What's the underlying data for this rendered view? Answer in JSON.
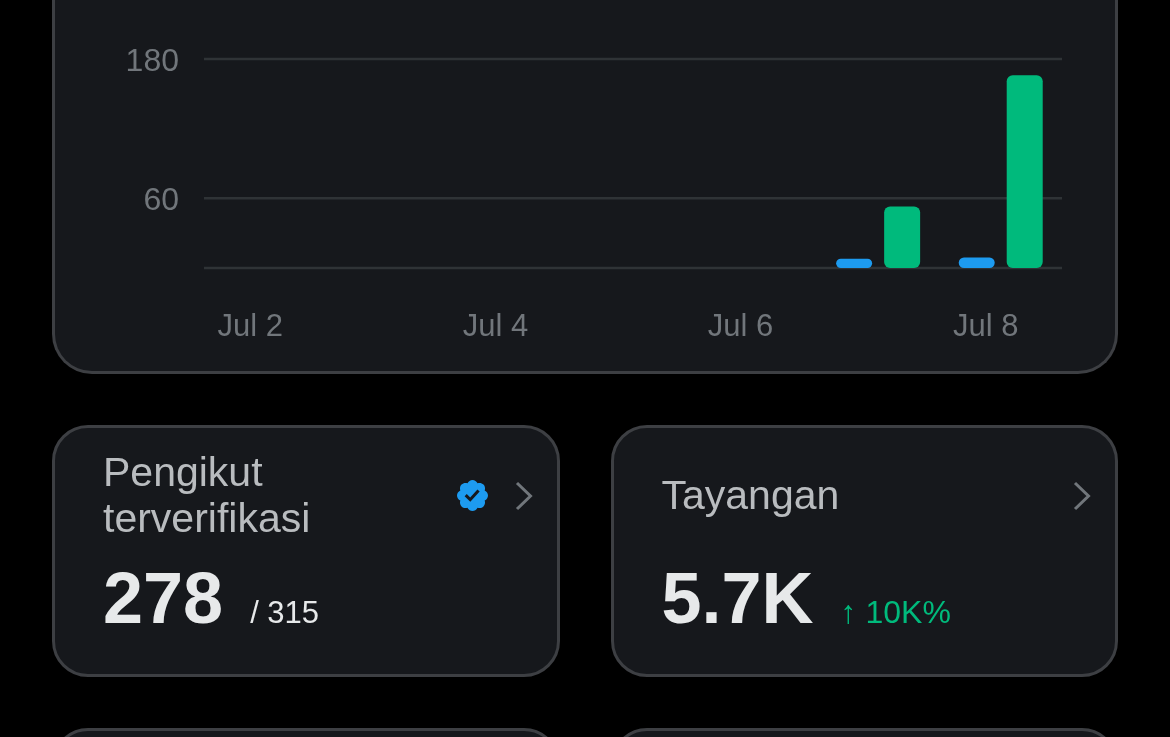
{
  "chart": {
    "chart_data": {
      "type": "bar",
      "categories": [
        "Jul 2",
        null,
        "Jul 4",
        null,
        "Jul 6",
        null,
        "Jul 8"
      ],
      "ylim": [
        0,
        180
      ],
      "yticks": [
        60,
        180
      ],
      "series": [
        {
          "color": "#1d9bf0",
          "values": [
            0,
            0,
            0,
            0,
            0,
            8,
            9
          ]
        },
        {
          "color": "#00ba7c",
          "values": [
            0,
            0,
            0,
            0,
            0,
            53,
            166
          ]
        }
      ]
    }
  },
  "stats": [
    {
      "kind": "metric",
      "title": "Pengikut terverifikasi",
      "verified": true,
      "value": "278",
      "total": "/ 315"
    },
    {
      "kind": "metric",
      "title": "Tayangan",
      "verified": false,
      "value": "5.7K",
      "change": {
        "text": "↑ 10K%",
        "positive": true
      }
    },
    {
      "kind": "cut_off"
    },
    {
      "kind": "cut_off"
    }
  ]
}
